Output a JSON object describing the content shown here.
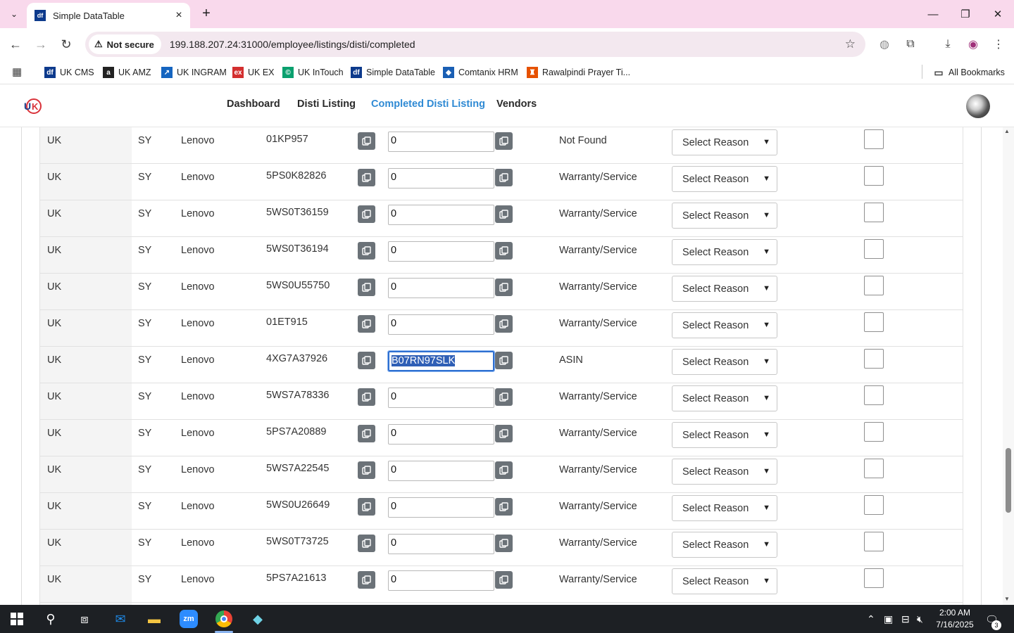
{
  "browser": {
    "tab_title": "Simple DataTable",
    "tab_favicon": "df",
    "security_label": "Not secure",
    "url": "199.188.207.24:31000/employee/listings/disti/completed",
    "bookmarks": [
      {
        "label": "UK CMS",
        "icon": "uk-cms-icon",
        "color": "#0d3a8c",
        "glyph": "df"
      },
      {
        "label": "UK AMZ",
        "icon": "amazon-icon",
        "color": "#222222",
        "glyph": "a"
      },
      {
        "label": "UK INGRAM",
        "icon": "ingram-icon",
        "color": "#1565c0",
        "glyph": "↗"
      },
      {
        "label": "UK EX",
        "icon": "ex-icon",
        "color": "#d32f2f",
        "glyph": "ex"
      },
      {
        "label": "UK InTouch",
        "icon": "intouch-icon",
        "color": "#0aa06e",
        "glyph": "©"
      },
      {
        "label": "Simple DataTable",
        "icon": "datatable-icon",
        "color": "#0d3a8c",
        "glyph": "df"
      },
      {
        "label": "Comtanix HRM",
        "icon": "comtanix-icon",
        "color": "#1a5fb4",
        "glyph": "◆"
      },
      {
        "label": "Rawalpindi Prayer Ti...",
        "icon": "prayer-icon",
        "color": "#e65100",
        "glyph": "♜"
      }
    ],
    "all_bookmarks": "All Bookmarks"
  },
  "nav": {
    "links": [
      "Dashboard",
      "Disti Listing",
      "Completed Disti Listing",
      "Vendors"
    ],
    "active_index": 2
  },
  "table": {
    "select_placeholder": "Select Reason",
    "rows": [
      {
        "region": "UK",
        "code": "SY",
        "brand": "Lenovo",
        "part": "01KP957",
        "value": "0",
        "status": "Not Found"
      },
      {
        "region": "UK",
        "code": "SY",
        "brand": "Lenovo",
        "part": "5PS0K82826",
        "value": "0",
        "status": "Warranty/Service"
      },
      {
        "region": "UK",
        "code": "SY",
        "brand": "Lenovo",
        "part": "5WS0T36159",
        "value": "0",
        "status": "Warranty/Service"
      },
      {
        "region": "UK",
        "code": "SY",
        "brand": "Lenovo",
        "part": "5WS0T36194",
        "value": "0",
        "status": "Warranty/Service"
      },
      {
        "region": "UK",
        "code": "SY",
        "brand": "Lenovo",
        "part": "5WS0U55750",
        "value": "0",
        "status": "Warranty/Service"
      },
      {
        "region": "UK",
        "code": "SY",
        "brand": "Lenovo",
        "part": "01ET915",
        "value": "0",
        "status": "Warranty/Service"
      },
      {
        "region": "UK",
        "code": "SY",
        "brand": "Lenovo",
        "part": "4XG7A37926",
        "value": "B07RN97SLK",
        "status": "ASIN",
        "focused": true
      },
      {
        "region": "UK",
        "code": "SY",
        "brand": "Lenovo",
        "part": "5WS7A78336",
        "value": "0",
        "status": "Warranty/Service"
      },
      {
        "region": "UK",
        "code": "SY",
        "brand": "Lenovo",
        "part": "5PS7A20889",
        "value": "0",
        "status": "Warranty/Service"
      },
      {
        "region": "UK",
        "code": "SY",
        "brand": "Lenovo",
        "part": "5WS7A22545",
        "value": "0",
        "status": "Warranty/Service"
      },
      {
        "region": "UK",
        "code": "SY",
        "brand": "Lenovo",
        "part": "5WS0U26649",
        "value": "0",
        "status": "Warranty/Service"
      },
      {
        "region": "UK",
        "code": "SY",
        "brand": "Lenovo",
        "part": "5WS0T73725",
        "value": "0",
        "status": "Warranty/Service"
      },
      {
        "region": "UK",
        "code": "SY",
        "brand": "Lenovo",
        "part": "5PS7A21613",
        "value": "0",
        "status": "Warranty/Service"
      },
      {
        "region": "",
        "code": "",
        "brand": "",
        "part": "",
        "value": "",
        "status": ""
      }
    ]
  },
  "taskbar": {
    "time": "2:00 AM",
    "date": "7/16/2025",
    "notifications": "3"
  },
  "colors": {
    "tab_strip": "#f9d9ec",
    "active_link": "#2f8ad4",
    "copy_button": "#6b7278",
    "selection": "#2f5fb6"
  }
}
